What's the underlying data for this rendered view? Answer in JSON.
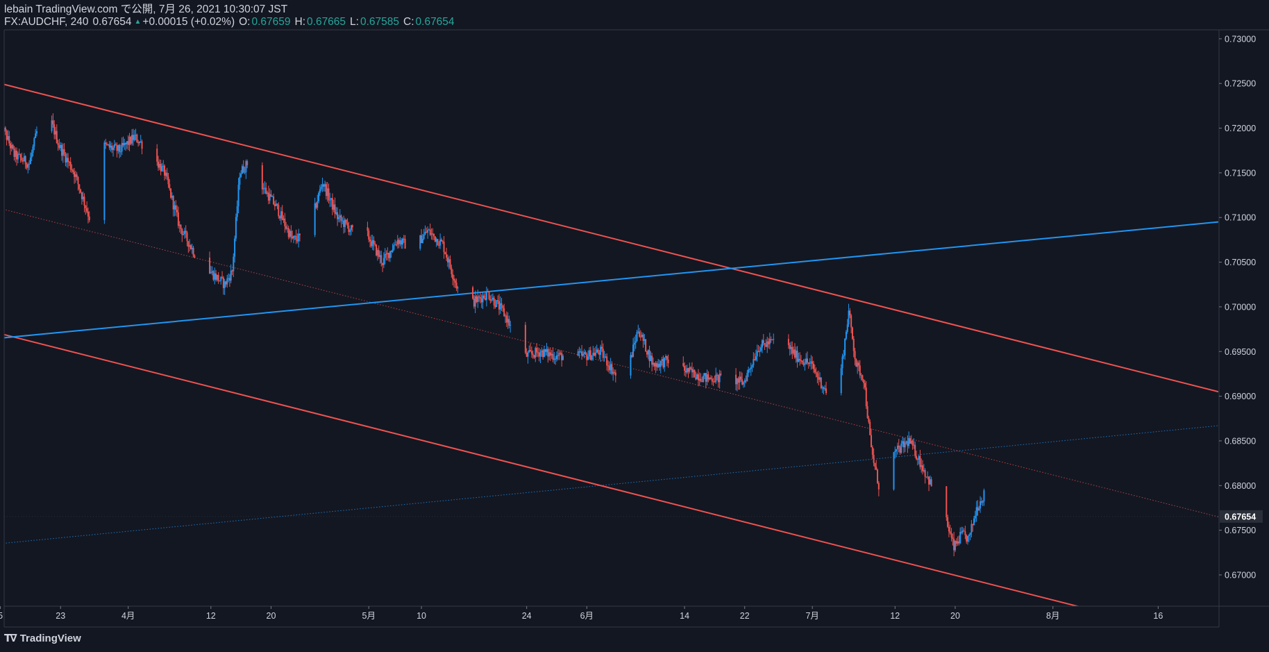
{
  "header": {
    "line1": "lebain TradingView.com で公開, 7月 26, 2021 10:30:07 JST",
    "symbol": "FX:AUDCHF, 240",
    "last": "0.67654",
    "change": "+0.00015 (+0.02%)",
    "o_label": "O:",
    "o_value": "0.67659",
    "h_label": "H:",
    "h_value": "0.67665",
    "l_label": "L:",
    "l_value": "0.67585",
    "c_label": "C:",
    "c_value": "0.67654"
  },
  "footer": {
    "brand": "TradingView"
  },
  "colors": {
    "background": "#131722",
    "up": "#2196f3",
    "down": "#ef5350",
    "text": "#d1d4dc",
    "accent": "#26a69a"
  },
  "chart_data": {
    "type": "candlestick",
    "symbol": "FX:AUDCHF",
    "interval": "240",
    "y_ticks": [
      "0.73000",
      "0.72500",
      "0.72000",
      "0.71500",
      "0.71000",
      "0.70500",
      "0.70000",
      "0.69500",
      "0.69000",
      "0.68500",
      "0.68000",
      "0.67500",
      "0.67000"
    ],
    "ylim": [
      0.6665,
      0.731
    ],
    "x_ticks": [
      {
        "label": "5",
        "date": "2021-03-15"
      },
      {
        "label": "23",
        "date": "2021-03-23"
      },
      {
        "label": "4月",
        "date": "2021-04-01"
      },
      {
        "label": "12",
        "date": "2021-04-12"
      },
      {
        "label": "20",
        "date": "2021-04-20"
      },
      {
        "label": "5月",
        "date": "2021-05-03"
      },
      {
        "label": "10",
        "date": "2021-05-10"
      },
      {
        "label": "24",
        "date": "2021-05-24"
      },
      {
        "label": "6月",
        "date": "2021-06-01"
      },
      {
        "label": "14",
        "date": "2021-06-14"
      },
      {
        "label": "22",
        "date": "2021-06-22"
      },
      {
        "label": "7月",
        "date": "2021-07-01"
      },
      {
        "label": "12",
        "date": "2021-07-12"
      },
      {
        "label": "20",
        "date": "2021-07-20"
      },
      {
        "label": "8月",
        "date": "2021-08-02"
      },
      {
        "label": "16",
        "date": "2021-08-16"
      }
    ],
    "last_price": "0.67654",
    "price_path": [
      [
        "2021-03-15",
        0.721
      ],
      [
        "2021-03-17",
        0.717
      ],
      [
        "2021-03-19",
        0.716
      ],
      [
        "2021-03-21",
        0.723
      ],
      [
        "2021-03-23",
        0.718
      ],
      [
        "2021-03-25",
        0.715
      ],
      [
        "2021-03-27",
        0.71
      ],
      [
        "2021-03-29",
        0.718
      ],
      [
        "2021-03-31",
        0.7175
      ],
      [
        "2021-04-02",
        0.719
      ],
      [
        "2021-04-04",
        0.7175
      ],
      [
        "2021-04-06",
        0.715
      ],
      [
        "2021-04-08",
        0.709
      ],
      [
        "2021-04-10",
        0.706
      ],
      [
        "2021-04-12",
        0.704
      ],
      [
        "2021-04-14",
        0.7025
      ],
      [
        "2021-04-15",
        0.704
      ],
      [
        "2021-04-16",
        0.715
      ],
      [
        "2021-04-17",
        0.716
      ],
      [
        "2021-04-19",
        0.7135
      ],
      [
        "2021-04-21",
        0.711
      ],
      [
        "2021-04-23",
        0.7075
      ],
      [
        "2021-04-25",
        0.708
      ],
      [
        "2021-04-27",
        0.714
      ],
      [
        "2021-04-29",
        0.71
      ],
      [
        "2021-05-01",
        0.7085
      ],
      [
        "2021-05-03",
        0.708
      ],
      [
        "2021-05-05",
        0.705
      ],
      [
        "2021-05-07",
        0.7075
      ],
      [
        "2021-05-09",
        0.7065
      ],
      [
        "2021-05-11",
        0.7085
      ],
      [
        "2021-05-13",
        0.707
      ],
      [
        "2021-05-15",
        0.702
      ],
      [
        "2021-05-17",
        0.7005
      ],
      [
        "2021-05-19",
        0.7015
      ],
      [
        "2021-05-21",
        0.6995
      ],
      [
        "2021-05-24",
        0.6945
      ],
      [
        "2021-05-26",
        0.695
      ],
      [
        "2021-05-28",
        0.6945
      ],
      [
        "2021-06-01",
        0.6945
      ],
      [
        "2021-06-03",
        0.695
      ],
      [
        "2021-06-06",
        0.691
      ],
      [
        "2021-06-08",
        0.6975
      ],
      [
        "2021-06-10",
        0.6935
      ],
      [
        "2021-06-12",
        0.694
      ],
      [
        "2021-06-14",
        0.693
      ],
      [
        "2021-06-17",
        0.692
      ],
      [
        "2021-06-20",
        0.692
      ],
      [
        "2021-06-22",
        0.6915
      ],
      [
        "2021-06-24",
        0.6955
      ],
      [
        "2021-06-27",
        0.6965
      ],
      [
        "2021-06-29",
        0.6945
      ],
      [
        "2021-07-01",
        0.6935
      ],
      [
        "2021-07-03",
        0.6905
      ],
      [
        "2021-07-05",
        0.693
      ],
      [
        "2021-07-06",
        0.6995
      ],
      [
        "2021-07-07",
        0.6935
      ],
      [
        "2021-07-08",
        0.692
      ],
      [
        "2021-07-09",
        0.684
      ],
      [
        "2021-07-10",
        0.68
      ],
      [
        "2021-07-11",
        0.683
      ],
      [
        "2021-07-12",
        0.6835
      ],
      [
        "2021-07-14",
        0.685
      ],
      [
        "2021-07-15",
        0.6835
      ],
      [
        "2021-07-17",
        0.68
      ],
      [
        "2021-07-19",
        0.676
      ],
      [
        "2021-07-20",
        0.673
      ],
      [
        "2021-07-21",
        0.6745
      ],
      [
        "2021-07-22",
        0.674
      ],
      [
        "2021-07-23",
        0.6775
      ],
      [
        "2021-07-24",
        0.679
      ],
      [
        "2021-07-25",
        0.6765
      ]
    ],
    "trendlines": [
      {
        "kind": "channel-upper",
        "color": "#ef5350",
        "from": [
          "2021-03-15",
          0.725
        ],
        "to": [
          "2021-08-24",
          0.6905
        ]
      },
      {
        "kind": "channel-mid",
        "color": "#ef5350",
        "dotted": true,
        "from": [
          "2021-03-15",
          0.711
        ],
        "to": [
          "2021-08-24",
          0.6765
        ]
      },
      {
        "kind": "channel-lower",
        "color": "#ef5350",
        "from": [
          "2021-03-15",
          0.697
        ],
        "to": [
          "2021-08-24",
          0.6625
        ]
      },
      {
        "kind": "rising",
        "color": "#2196f3",
        "from": [
          "2021-03-15",
          0.6965
        ],
        "to": [
          "2021-08-24",
          0.7095
        ]
      },
      {
        "kind": "rising-parallel",
        "color": "#2196f3",
        "dotted": true,
        "from": [
          "2021-03-15",
          0.6735
        ],
        "to": [
          "2021-08-24",
          0.6867
        ]
      }
    ]
  }
}
